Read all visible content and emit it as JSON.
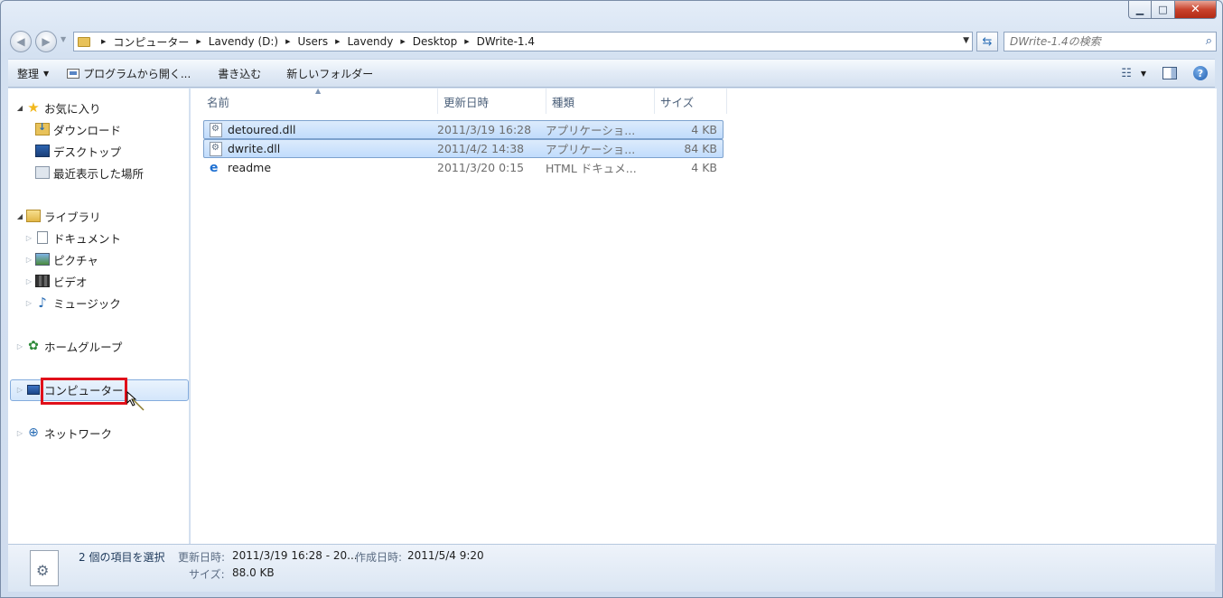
{
  "window": {
    "caption": {
      "minimize": "▁",
      "maximize": "□",
      "close": "✕"
    }
  },
  "nav": {
    "back_icon": "◀",
    "forward_icon": "▶",
    "breadcrumb": [
      "コンピューター",
      "Lavendy (D:)",
      "Users",
      "Lavendy",
      "Desktop",
      "DWrite-1.4"
    ],
    "refresh_icon": "⇆",
    "search_placeholder": "DWrite-1.4の検索",
    "search_icon": "⌕"
  },
  "toolbar": {
    "organize": "整理",
    "open_with": "プログラムから開く...",
    "burn": "書き込む",
    "new_folder": "新しいフォルダー"
  },
  "sidebar": {
    "favorites": {
      "label": "お気に入り",
      "items": [
        "ダウンロード",
        "デスクトップ",
        "最近表示した場所"
      ]
    },
    "libraries": {
      "label": "ライブラリ",
      "items": [
        "ドキュメント",
        "ピクチャ",
        "ビデオ",
        "ミュージック"
      ]
    },
    "homegroup": "ホームグループ",
    "computer": "コンピューター",
    "network": "ネットワーク"
  },
  "columns": {
    "name": "名前",
    "modified": "更新日時",
    "type": "種類",
    "size": "サイズ"
  },
  "files": [
    {
      "name": "detoured.dll",
      "modified": "2011/3/19 16:28",
      "type": "アプリケーショ...",
      "size": "4 KB",
      "selected": true
    },
    {
      "name": "dwrite.dll",
      "modified": "2011/4/2 14:38",
      "type": "アプリケーショ...",
      "size": "84 KB",
      "selected": true
    },
    {
      "name": "readme",
      "modified": "2011/3/20 0:15",
      "type": "HTML ドキュメ...",
      "size": "4 KB",
      "selected": false
    }
  ],
  "details": {
    "selection": "2 個の項目を選択",
    "modified_label": "更新日時:",
    "modified_value": "2011/3/19 16:28 - 20...",
    "created_label": "作成日時:",
    "created_value": "2011/5/4 9:20",
    "size_label": "サイズ:",
    "size_value": "88.0 KB"
  }
}
